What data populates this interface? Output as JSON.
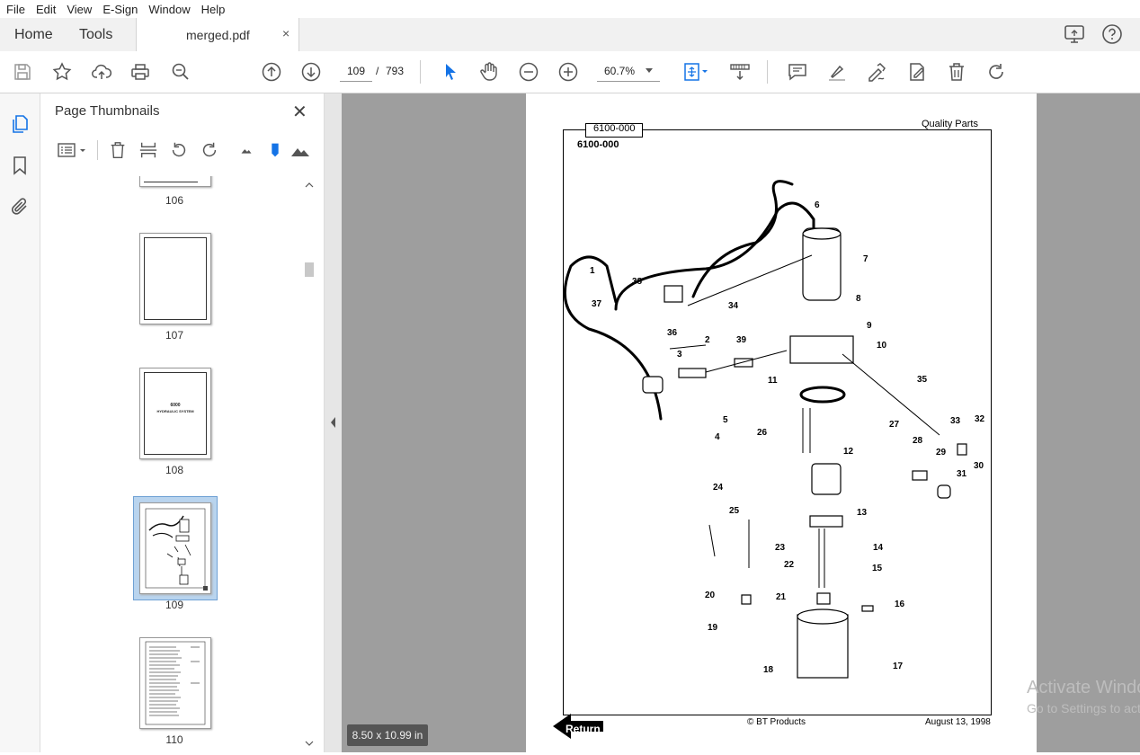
{
  "menu": {
    "file": "File",
    "edit": "Edit",
    "view": "View",
    "esign": "E-Sign",
    "window": "Window",
    "help": "Help"
  },
  "tabs": {
    "home": "Home",
    "tools": "Tools",
    "document": "merged.pdf",
    "close": "×"
  },
  "toolbar": {
    "current_page": "109",
    "page_sep": "/",
    "total_pages": "793",
    "zoom": "60.7%"
  },
  "icons": [
    "save-icon",
    "star-icon",
    "upload-icon",
    "print-icon",
    "zoom-out-search-icon",
    "prev-page-icon",
    "next-page-icon",
    "select-cursor-icon",
    "hand-icon",
    "zoom-minus-icon",
    "zoom-plus-icon",
    "fit-page-icon",
    "scroll-mode-icon",
    "comment-icon",
    "highlight-icon",
    "sign-icon",
    "edit-pdf-icon",
    "delete-icon",
    "redo-icon"
  ],
  "panel": {
    "title": "Page Thumbnails",
    "close": "✕",
    "thumbnails": [
      {
        "label": "106"
      },
      {
        "label": "107"
      },
      {
        "label": "108",
        "heading": "6000",
        "subheading": "HYDRAULIC SYSTEM"
      },
      {
        "label": "109",
        "selected": true
      },
      {
        "label": "110"
      }
    ]
  },
  "viewer": {
    "page_size": "8.50 x 10.99 in"
  },
  "pdf": {
    "header_tab": "6100-000",
    "part_code": "6100-000",
    "brand": "Quality Parts",
    "footer_left": "© BT Products",
    "footer_right": "August 13, 1998",
    "return_label": "Return",
    "callouts": [
      "1",
      "2",
      "3",
      "4",
      "5",
      "6",
      "7",
      "8",
      "9",
      "10",
      "11",
      "12",
      "13",
      "14",
      "15",
      "16",
      "17",
      "18",
      "19",
      "20",
      "21",
      "22",
      "23",
      "24",
      "25",
      "26",
      "27",
      "28",
      "29",
      "30",
      "31",
      "32",
      "33",
      "34",
      "35",
      "36",
      "37",
      "38",
      "39"
    ]
  },
  "watermark": {
    "line1": "Activate Windows",
    "line2": "Go to Settings to activate Windows."
  }
}
